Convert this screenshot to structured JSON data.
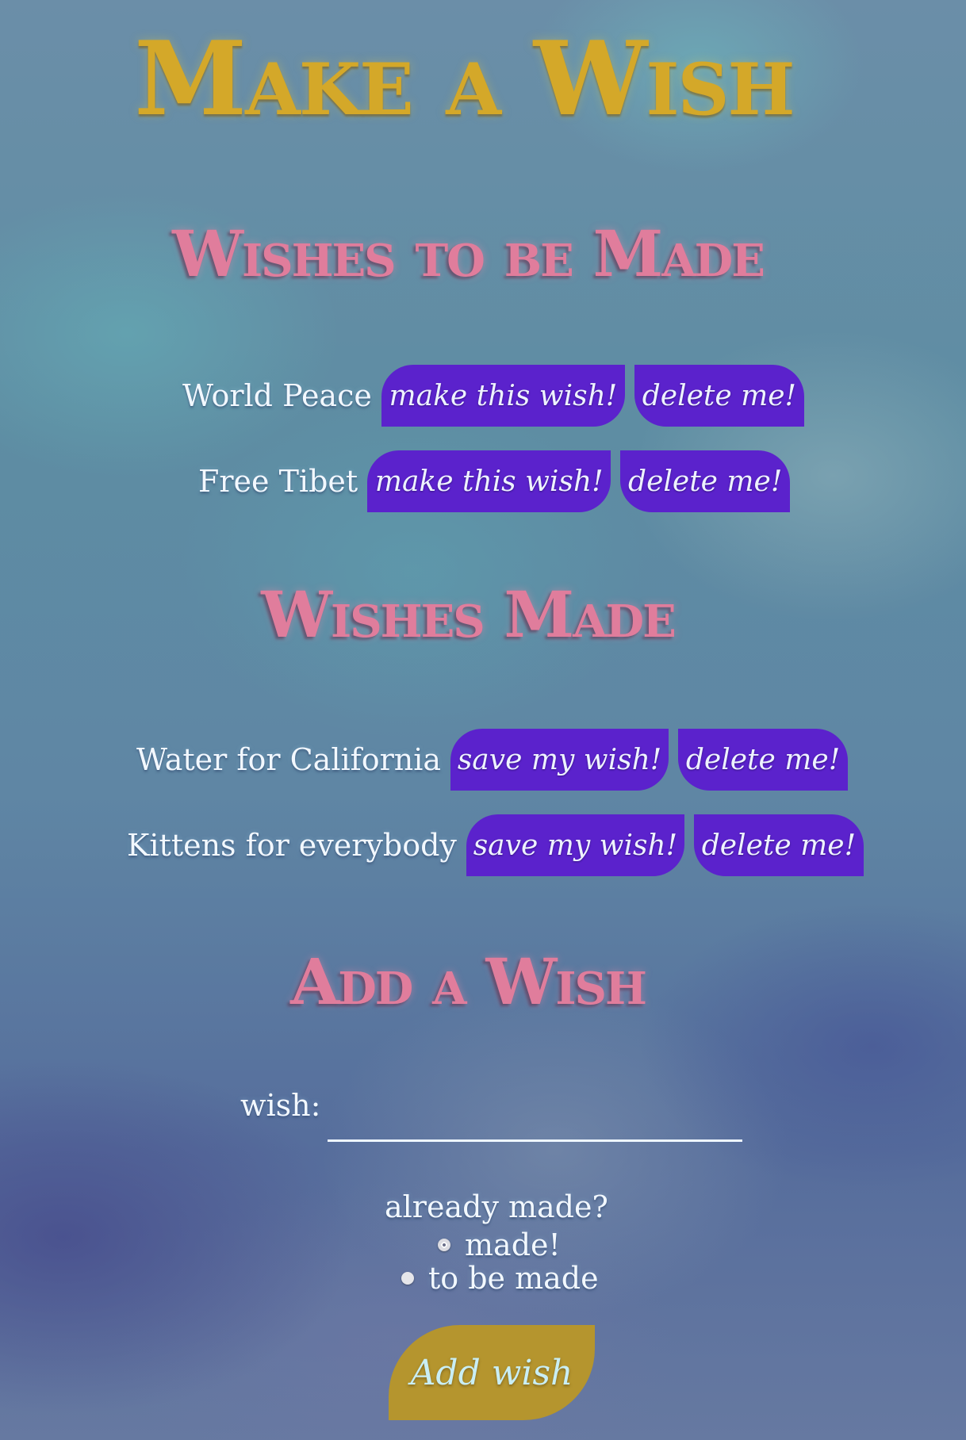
{
  "app_title": "Make a Wish",
  "sections": {
    "to_be_made_heading": "Wishes to be Made",
    "made_heading": "Wishes Made",
    "add_heading": "Add a Wish"
  },
  "wishes_to_be_made": [
    {
      "text": "World Peace",
      "action": "make this wish!",
      "delete": "delete me!"
    },
    {
      "text": "Free Tibet",
      "action": "make this wish!",
      "delete": "delete me!"
    }
  ],
  "wishes_made": [
    {
      "text": "Water for California",
      "action": "save my wish!",
      "delete": "delete me!"
    },
    {
      "text": "Kittens for everybody",
      "action": "save my wish!",
      "delete": "delete me!"
    }
  ],
  "form": {
    "wish_label": "wish:",
    "wish_value": "",
    "already_made_label": "already made?",
    "options": [
      {
        "label": "made!",
        "checked": true
      },
      {
        "label": "to be made",
        "checked": false
      }
    ],
    "submit_label": "Add wish"
  },
  "colors": {
    "title": "#d4a829",
    "heading": "#e07d9c",
    "pill": "#5b22cc",
    "submit": "#b5952e"
  }
}
